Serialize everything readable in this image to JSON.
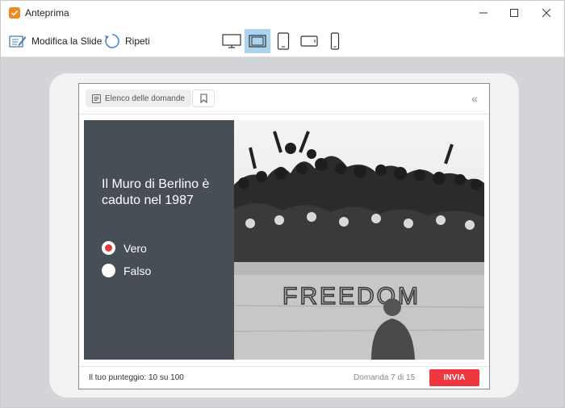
{
  "window": {
    "title": "Anteprima",
    "icon": "checkbox-app-icon",
    "accent": "#f08a24"
  },
  "toolbar": {
    "edit_label": "Modifica la Slide",
    "repeat_label": "Ripeti",
    "devices": [
      "desktop",
      "laptop",
      "tablet-portrait",
      "tablet-landscape",
      "phone"
    ],
    "active_device": "laptop"
  },
  "player": {
    "question_list_label": "Elenco delle domande",
    "collapse_symbol": "«",
    "question": "Il Muro di Berlino è caduto nel 1987",
    "answers": [
      {
        "label": "Vero",
        "selected": true
      },
      {
        "label": "Falso",
        "selected": false
      }
    ],
    "photo_caption_text": "FREEDOM",
    "score_label": "Il tuo punteggio: 10 su 100",
    "progress_label": "Domanda 7 di 15",
    "submit_label": "INVIA",
    "submit_color": "#f0363f",
    "panel_color": "#484e55"
  }
}
